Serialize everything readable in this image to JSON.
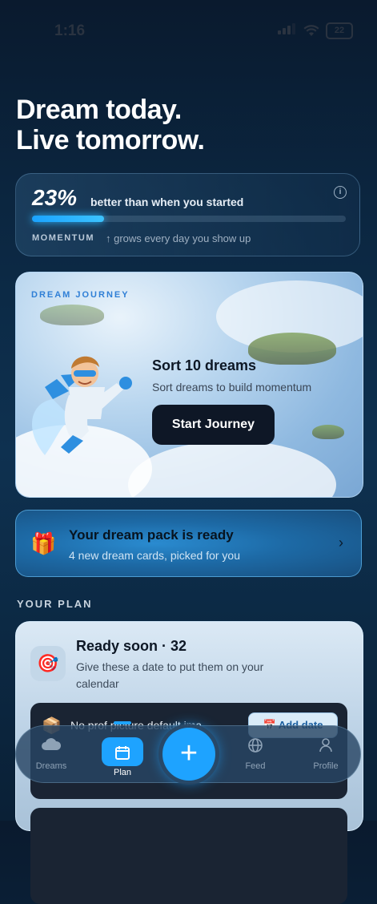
{
  "status": {
    "time": "1:16",
    "battery": "22"
  },
  "headline": {
    "line1": "Dream today.",
    "line2": "Live tomorrow."
  },
  "momentum": {
    "percent": "23%",
    "percent_label": "better than when you started",
    "label": "MOMENTUM",
    "hint": "↑ grows every day you show up",
    "progress": 0.23,
    "info_icon": "info-icon"
  },
  "journey": {
    "tag": "DREAM JOURNEY",
    "title": "Sort 10 dreams",
    "subtitle": "Sort dreams to build momentum",
    "button": "Start Journey"
  },
  "gift": {
    "title": "Your dream pack is ready",
    "subtitle": "4 new dream cards, picked for you",
    "icon": "gift-icon"
  },
  "plan": {
    "section": "YOUR PLAN",
    "title": "Ready soon · 32",
    "subtitle": "Give these a date to put them on your calendar",
    "rows": [
      {
        "text": "No prof picture default ima",
        "button": "Add date"
      },
      {
        "text": "",
        "button": ""
      }
    ]
  },
  "tabs": [
    {
      "label": "Dreams",
      "icon": "cloud-icon"
    },
    {
      "label": "Plan",
      "icon": "calendar-icon"
    },
    {
      "label": "",
      "icon": "plus-icon"
    },
    {
      "label": "Feed",
      "icon": "globe-icon"
    },
    {
      "label": "Profile",
      "icon": "person-icon"
    }
  ],
  "colors": {
    "accent": "#1ea3ff",
    "dark": "#0e1726"
  }
}
